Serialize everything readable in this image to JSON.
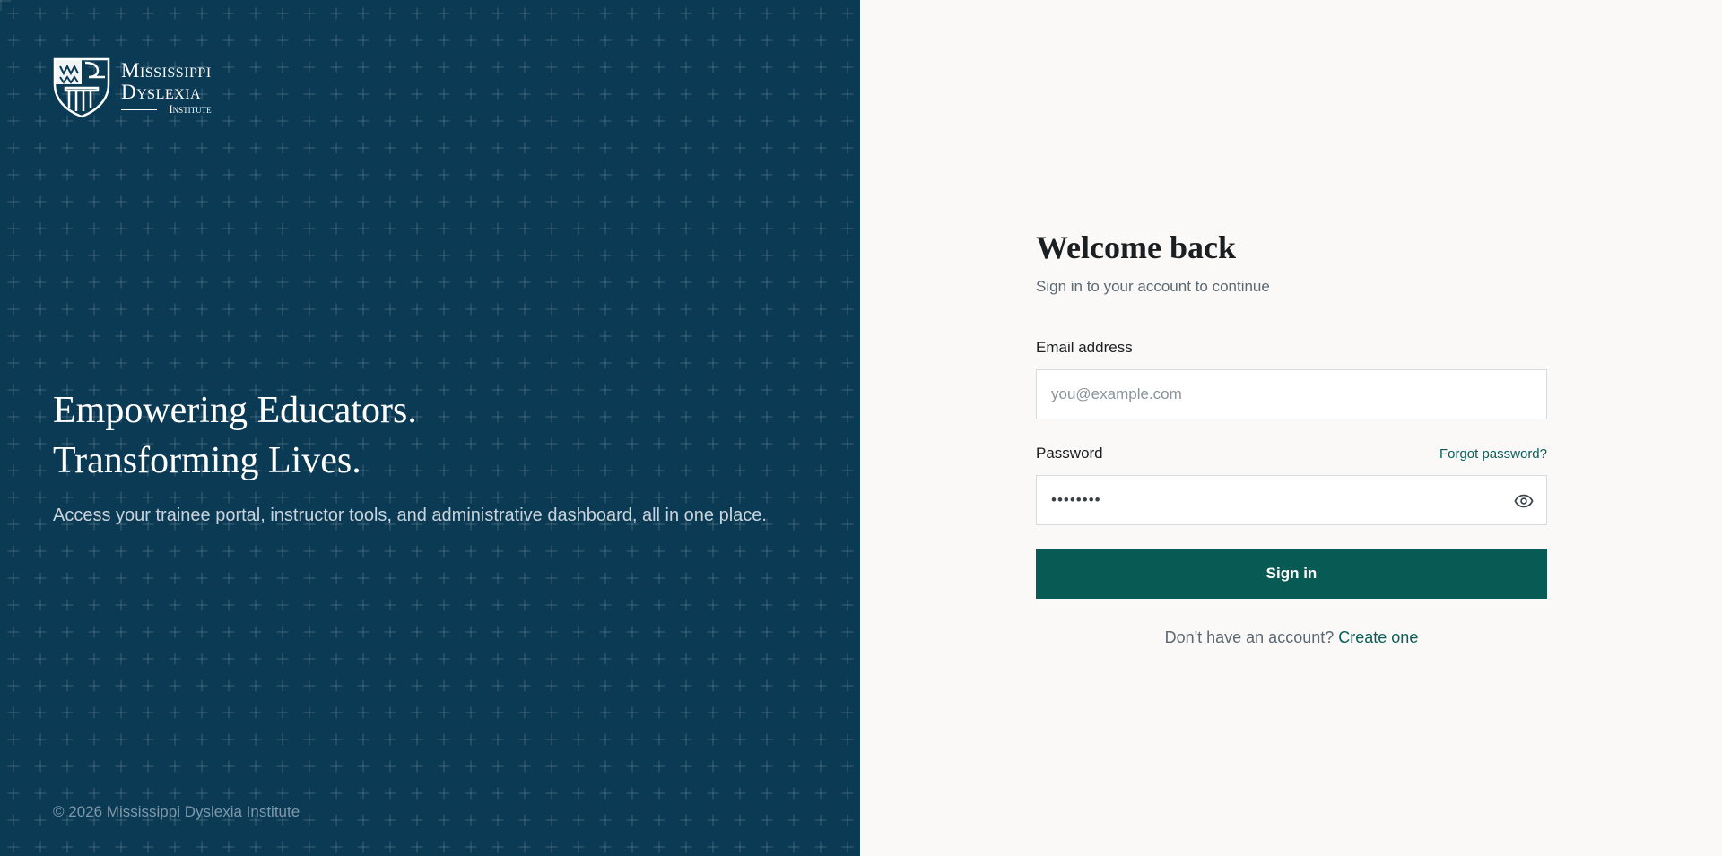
{
  "brand": {
    "line1": "Mississippi",
    "line2": "Dyslexia",
    "line3": "Institute"
  },
  "hero": {
    "line1": "Empowering Educators.",
    "line2": "Transforming Lives.",
    "subtitle": "Access your trainee portal, instructor tools, and administrative dashboard, all in one place."
  },
  "footer": {
    "copyright": "© 2026 Mississippi Dyslexia Institute"
  },
  "login": {
    "title": "Welcome back",
    "subtitle": "Sign in to your account to continue",
    "email_label": "Email address",
    "email_placeholder": "you@example.com",
    "password_label": "Password",
    "forgot_label": "Forgot password?",
    "password_value": "••••••••",
    "submit_label": "Sign in",
    "signup_prompt": "Don't have an account?",
    "signup_link": "Create one"
  },
  "icons": {
    "logo": "shield-crest-icon",
    "password_toggle": "eye-icon"
  },
  "colors": {
    "left_panel": "#0b3a55",
    "primary_button": "#085a55",
    "link": "#0b5c58",
    "background": "#faf9f7"
  }
}
